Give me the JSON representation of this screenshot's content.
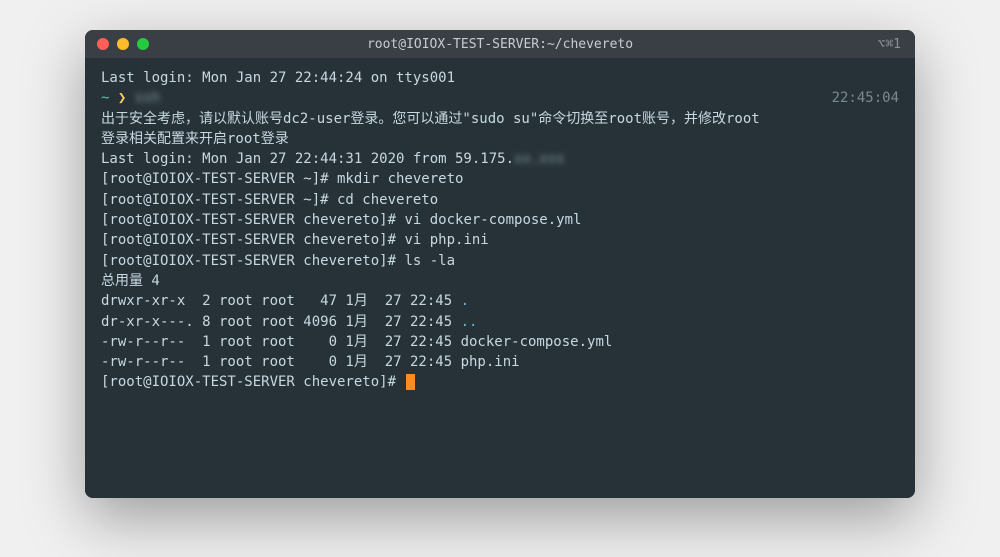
{
  "titlebar": {
    "title": "root@IOIOX-TEST-SERVER:~/chevereto",
    "right": "⌥⌘1"
  },
  "body": {
    "last_login_top": "Last login: Mon Jan 27 22:44:24 on ttys001",
    "prompt_tilde": "~",
    "prompt_arrow": "❯",
    "blurred_cmd": "ssh  ",
    "time_right": "22:45:04",
    "security_line1": "出于安全考虑，请以默认账号dc2-user登录。您可以通过\"sudo su\"命令切换至root账号，并修改root",
    "security_line2": "登录相关配置来开启root登录",
    "last_login2": "Last login: Mon Jan 27 22:44:31 2020 from 59.175.",
    "blurred_ip": "xx.xxx",
    "prompts": [
      {
        "host": "[root@IOIOX-TEST-SERVER ~]#",
        "cmd": " mkdir chevereto"
      },
      {
        "host": "[root@IOIOX-TEST-SERVER ~]#",
        "cmd": " cd chevereto"
      },
      {
        "host": "[root@IOIOX-TEST-SERVER chevereto]#",
        "cmd": " vi docker-compose.yml"
      },
      {
        "host": "[root@IOIOX-TEST-SERVER chevereto]#",
        "cmd": " vi php.ini"
      },
      {
        "host": "[root@IOIOX-TEST-SERVER chevereto]#",
        "cmd": " ls -la"
      }
    ],
    "ls_total": "总用量 4",
    "ls_rows": [
      {
        "perm": "drwxr-xr-x  2 root root   47 1月  27 22:45 ",
        "name": ".",
        "is_dir": true
      },
      {
        "perm": "dr-xr-x---. 8 root root 4096 1月  27 22:45 ",
        "name": "..",
        "is_dir": true
      },
      {
        "perm": "-rw-r--r--  1 root root    0 1月  27 22:45 ",
        "name": "docker-compose.yml",
        "is_dir": false
      },
      {
        "perm": "-rw-r--r--  1 root root    0 1月  27 22:45 ",
        "name": "php.ini",
        "is_dir": false
      }
    ],
    "final_prompt": "[root@IOIOX-TEST-SERVER chevereto]# "
  }
}
